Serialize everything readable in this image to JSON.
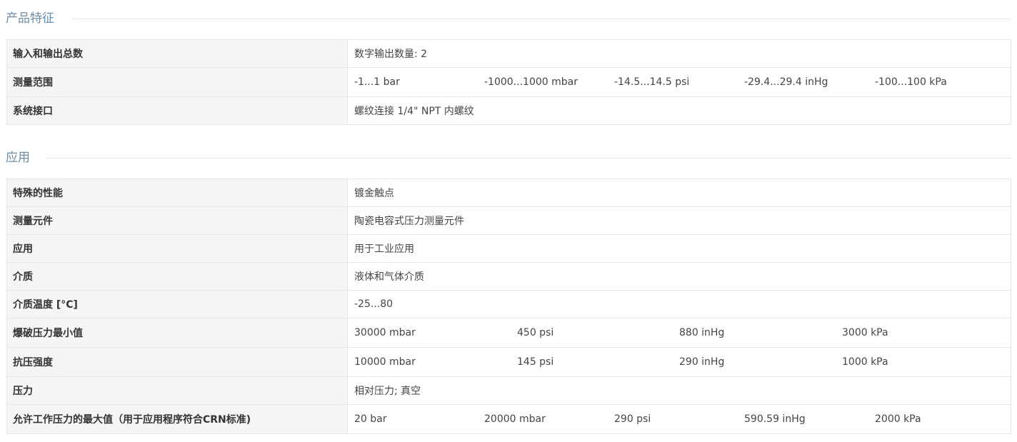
{
  "section1": {
    "title": "产品特征",
    "rows": [
      {
        "label": "输入和输出总数",
        "value": "数字输出数量: 2"
      },
      {
        "label": "测量范围",
        "values": [
          "-1...1 bar",
          "-1000...1000 mbar",
          "-14.5...14.5 psi",
          "-29.4...29.4 inHg",
          "-100...100 kPa"
        ]
      },
      {
        "label": "系统接口",
        "value": "螺纹连接 1/4\" NPT 内螺纹"
      }
    ]
  },
  "section2": {
    "title": "应用",
    "rows": [
      {
        "label": "特殊的性能",
        "value": "镀金触点"
      },
      {
        "label": "测量元件",
        "value": "陶瓷电容式压力测量元件"
      },
      {
        "label": "应用",
        "value": "用于工业应用"
      },
      {
        "label": "介质",
        "value": "液体和气体介质"
      },
      {
        "label": "介质温度 [°C]",
        "value": "-25...80"
      },
      {
        "label": "爆破压力最小值",
        "values": [
          "30000 mbar",
          "450 psi",
          "880 inHg",
          "3000 kPa"
        ]
      },
      {
        "label": "抗压强度",
        "values": [
          "10000 mbar",
          "145 psi",
          "290 inHg",
          "1000 kPa"
        ]
      },
      {
        "label": "压力",
        "value": "相对压力; 真空"
      },
      {
        "label": "允许工作压力的最大值（用于应用程序符合CRN标准)",
        "values": [
          "20 bar",
          "20000 mbar",
          "290 psi",
          "590.59 inHg",
          "2000 kPa"
        ]
      }
    ]
  }
}
